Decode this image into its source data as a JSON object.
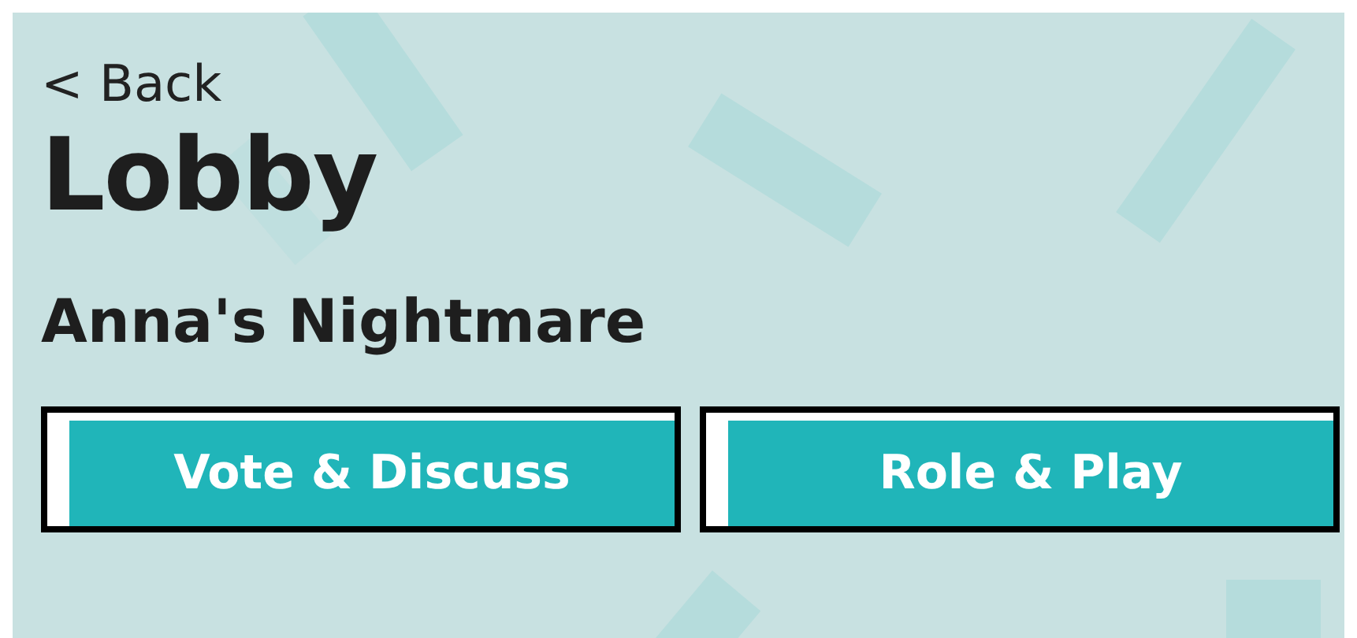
{
  "back_link": {
    "label": "< Back"
  },
  "title": "Lobby",
  "subtitle": "Anna's Nightmare",
  "buttons": [
    {
      "label": "Vote & Discuss"
    },
    {
      "label": "Role & Play"
    }
  ]
}
